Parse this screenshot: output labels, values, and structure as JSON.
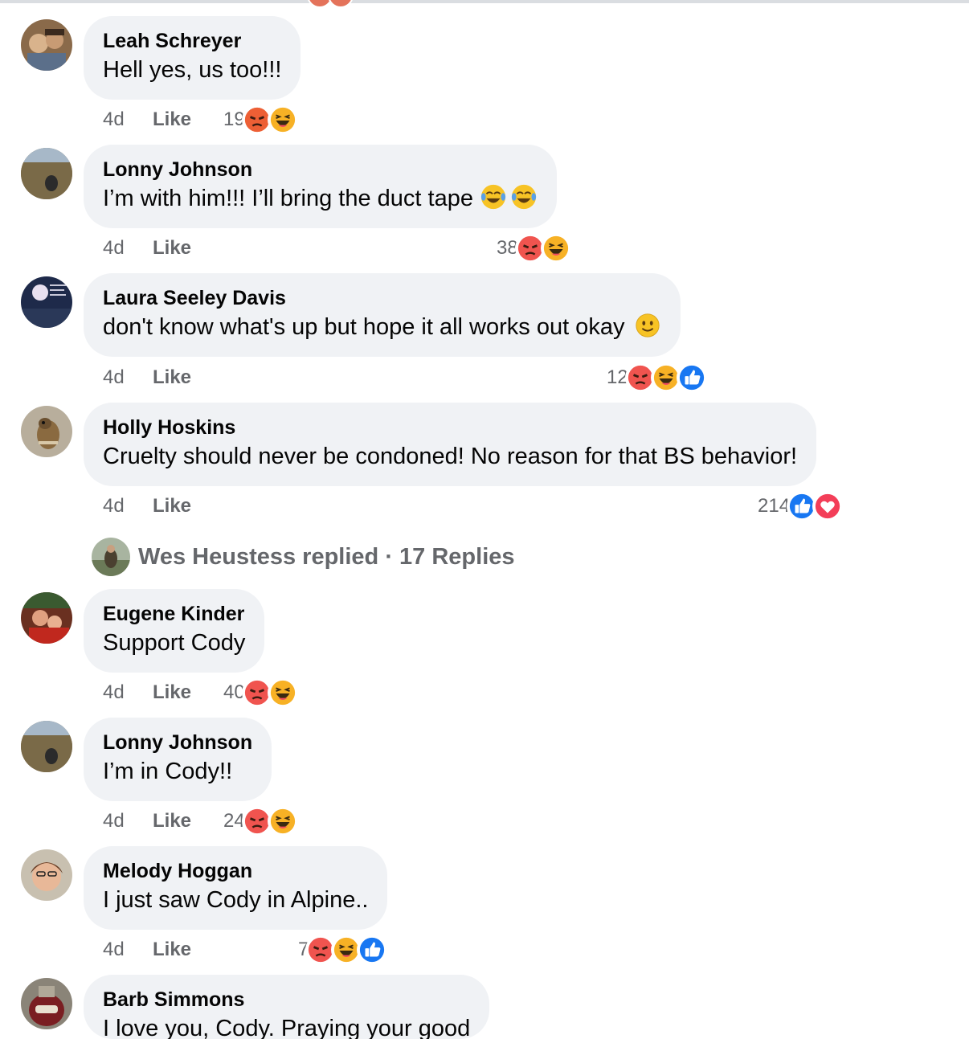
{
  "comments": [
    {
      "name": "Leah Schreyer",
      "text": "Hell yes, us too!!!",
      "time": "4d",
      "like": "Like",
      "count": "19",
      "reactions": [
        "angry",
        "haha"
      ],
      "emoji": []
    },
    {
      "name": "Lonny Johnson",
      "text": "I’m with him!!! I’ll bring the duct tape",
      "time": "4d",
      "like": "Like",
      "count": "38",
      "reactions": [
        "angry",
        "haha"
      ],
      "emoji": [
        "tears-of-joy",
        "tears-of-joy"
      ]
    },
    {
      "name": "Laura Seeley Davis",
      "text": "don't know what's up but hope it all works out okay",
      "time": "4d",
      "like": "Like",
      "count": "12",
      "reactions": [
        "angry",
        "haha",
        "like"
      ],
      "emoji": [
        "smile"
      ]
    },
    {
      "name": "Holly Hoskins",
      "text": "Cruelty should never be condoned! No reason for that BS behavior!",
      "time": "4d",
      "like": "Like",
      "count": "214",
      "reactions": [
        "like",
        "love"
      ],
      "emoji": []
    },
    {
      "name": "Eugene Kinder",
      "text": "Support Cody",
      "time": "4d",
      "like": "Like",
      "count": "40",
      "reactions": [
        "angry",
        "haha"
      ],
      "emoji": []
    },
    {
      "name": "Lonny Johnson",
      "text": "I’m in Cody!!",
      "time": "4d",
      "like": "Like",
      "count": "24",
      "reactions": [
        "angry",
        "haha"
      ],
      "emoji": []
    },
    {
      "name": "Melody Hoggan",
      "text": "I just saw Cody in Alpine..",
      "time": "4d",
      "like": "Like",
      "count": "7",
      "reactions": [
        "angry",
        "haha",
        "like"
      ],
      "emoji": []
    },
    {
      "name": "Barb Simmons",
      "text": "I love you, Cody. Praying your good",
      "emoji": []
    }
  ],
  "replies": {
    "text": "Wes Heustess replied · 17 Replies"
  },
  "colors": {
    "bubble": "#f0f2f5",
    "meta": "#65676b",
    "like_blue": "#1877f2",
    "love_red": "#f33e58",
    "angry": "#e9710f",
    "haha": "#f7b125"
  }
}
